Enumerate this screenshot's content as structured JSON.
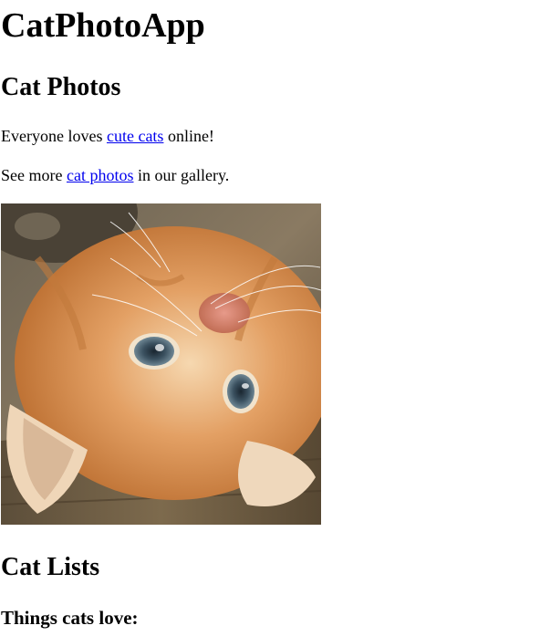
{
  "app": {
    "title": "CatPhotoApp"
  },
  "photos_section": {
    "heading": "Cat Photos",
    "line1": {
      "before": "Everyone loves ",
      "link": "cute cats",
      "after": " online!"
    },
    "line2": {
      "before": "See more ",
      "link": "cat photos",
      "after": " in our gallery."
    },
    "image_alt": "A cute orange cat lying on its back."
  },
  "lists_section": {
    "heading": "Cat Lists",
    "subheading": "Things cats love:"
  },
  "colors": {
    "link": "#0000ee",
    "text": "#000000",
    "background": "#ffffff"
  }
}
